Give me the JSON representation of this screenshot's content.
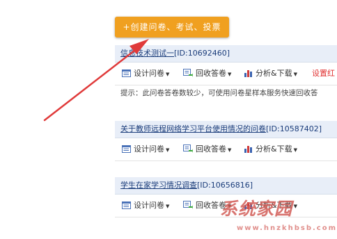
{
  "create_button_label": "+创建问卷、考试、投票",
  "surveys": [
    {
      "title": "信息技术测试一",
      "id_text": "[ID:10692460]",
      "tools": {
        "design": "设计问卷",
        "collect": "回收答卷",
        "analyze": "分析&下载",
        "extra": "设置红"
      },
      "tip": "提示：此问卷答卷数较少，可使用问卷星样本服务快速回收答"
    },
    {
      "title": "关于教师远程网络学习平台使用情况的问卷",
      "id_text": "[ID:10587402]",
      "tools": {
        "design": "设计问卷",
        "collect": "回收答卷",
        "analyze": "分析&下载"
      }
    },
    {
      "title": "学生在家学习情况调查",
      "id_text": "[ID:10656816]",
      "tools": {
        "design": "设计问卷",
        "collect": "回收答卷",
        "analyze": "分析&下载"
      }
    }
  ],
  "watermark": {
    "text": "系统家园",
    "sub": "www.hnzkhbsb.com"
  },
  "colors": {
    "accent": "#f0a020",
    "arrow": "#e03a3a",
    "header_bg": "#e8eef8"
  }
}
